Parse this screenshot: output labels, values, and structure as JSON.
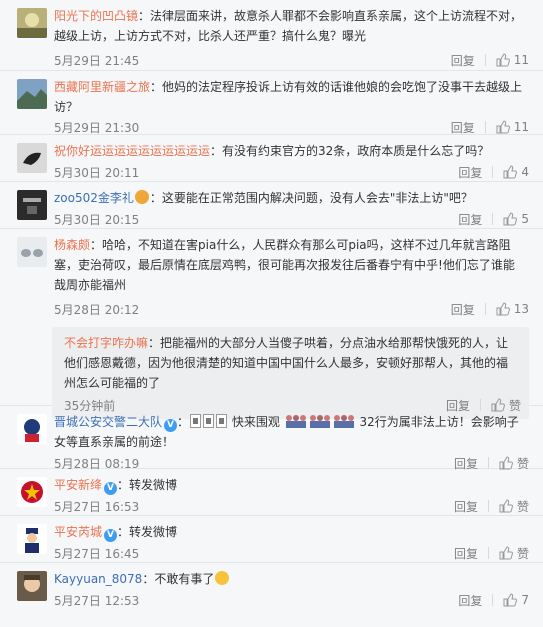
{
  "comments": [
    {
      "user": "阳光下的凹凸镜",
      "text": "：法律层面来讲，故意杀人罪都不会影响直系亲属，这个上访流程不对，越级上访，上访方式不对，比杀人还严重？搞什么鬼？曝光",
      "time": "5月29日 21:45",
      "reply": "回复",
      "likes": "11"
    },
    {
      "user": "西藏阿里新疆之旅",
      "text": "：他妈的法定程序投诉上访有效的话谁他娘的会吃饱了没事干去越级上访？",
      "time": "5月29日 21:30",
      "reply": "回复",
      "likes": "11"
    },
    {
      "user": "祝你好运运运运运运运运运运",
      "text": "：有没有约束官方的32条，政府本质是什么忘了吗？",
      "time": "5月30日 20:11",
      "reply": "回复",
      "likes": "4"
    },
    {
      "user": "zoo502金李礼",
      "text": "：这要能在正常范围内解决问题，没有人会去\"非法上访\"吧？",
      "time": "5月30日 20:15",
      "reply": "回复",
      "likes": "5"
    },
    {
      "user": "杨森颇",
      "text": "：哈哈，不知道在害pia什么，人民群众有那么可pia吗，这样不过几年就言路阻塞，吏治荷叹，最后原情在底层鸡鸭，很可能再次报发往后番春宁有中乎!他们忘了谁能哉周亦能福州",
      "time": "5月28日 20:12",
      "reply": "回复",
      "likes": "13",
      "sub": {
        "user": "不会打字咋办嘛",
        "text": "：把能福州的大部分人当傻子哄着，分点油水给那帮快饿死的人，让他们感恩戴德，因为他很清楚的知道中国中国什么人最多，安顿好那帮人，其他的福州怎么可能福的了",
        "time": "35分钟前",
        "reply": "回复",
        "likes": "赞"
      }
    },
    {
      "user": "晋城公安交警二大队",
      "text_before": "：",
      "text_mid": "快来围观",
      "text_after": "32行为属非法上访！会影响子女等直系亲属的前途！",
      "time": "5月28日 08:19",
      "reply": "回复",
      "likes": "赞"
    },
    {
      "user": "平安新绛",
      "text": "：转发微博",
      "time": "5月27日 16:53",
      "reply": "回复",
      "likes": "赞"
    },
    {
      "user": "平安芮城",
      "text": "：转发微博",
      "time": "5月27日 16:45",
      "reply": "回复",
      "likes": "赞"
    },
    {
      "user": "Kayyuan_8078",
      "text": "：不敢有事了",
      "time": "5月27日 12:53",
      "reply": "回复",
      "likes": "7"
    }
  ],
  "colors": {
    "orange_name": "#eb7350",
    "blue_name": "#3c6fb5",
    "gray": "#808080"
  },
  "icons": {
    "like": "thumbs-up-icon",
    "verified": "verified-v-icon"
  }
}
